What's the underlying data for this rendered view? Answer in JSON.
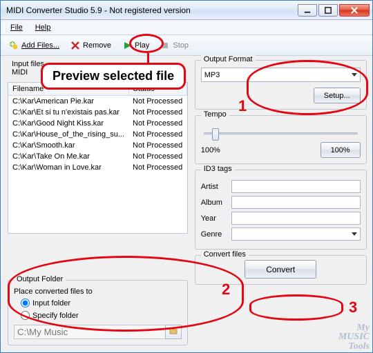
{
  "title": "MIDI Converter Studio 5.9 - Not registered version",
  "menu": {
    "file": "File",
    "help": "Help"
  },
  "toolbar": {
    "add": "Add Files...",
    "remove": "Remove",
    "play": "Play",
    "stop": "Stop"
  },
  "input": {
    "heading": "Input files",
    "subhead": "MIDI",
    "cols": {
      "filename": "Filename",
      "status": "Status"
    },
    "rows": [
      {
        "file": "C:\\Kar\\American Pie.kar",
        "status": "Not Processed"
      },
      {
        "file": "C:\\Kar\\Et si tu n'existais pas.kar",
        "status": "Not Processed"
      },
      {
        "file": "C:\\Kar\\Good Night Kiss.kar",
        "status": "Not Processed"
      },
      {
        "file": "C:\\Kar\\House_of_the_rising_su...",
        "status": "Not Processed"
      },
      {
        "file": "C:\\Kar\\Smooth.kar",
        "status": "Not Processed"
      },
      {
        "file": "C:\\Kar\\Take On Me.kar",
        "status": "Not Processed"
      },
      {
        "file": "C:\\Kar\\Woman in Love.kar",
        "status": "Not Processed"
      }
    ]
  },
  "outfolder": {
    "legend": "Output Folder",
    "label": "Place converted files to",
    "opt_input": "Input folder",
    "opt_specify": "Specify folder",
    "path": "C:\\My Music"
  },
  "format": {
    "legend": "Output Format",
    "value": "MP3",
    "setup": "Setup..."
  },
  "tempo": {
    "legend": "Tempo",
    "left": "100%",
    "btn": "100%"
  },
  "id3": {
    "legend": "ID3 tags",
    "artist": "Artist",
    "album": "Album",
    "year": "Year",
    "genre": "Genre"
  },
  "convert": {
    "legend": "Convert files",
    "btn": "Convert"
  },
  "annot": {
    "preview": "Preview selected file",
    "n1": "1",
    "n2": "2",
    "n3": "3"
  },
  "watermark": {
    "l1": "My",
    "l2": "MUSIC",
    "l3": "Tools"
  }
}
